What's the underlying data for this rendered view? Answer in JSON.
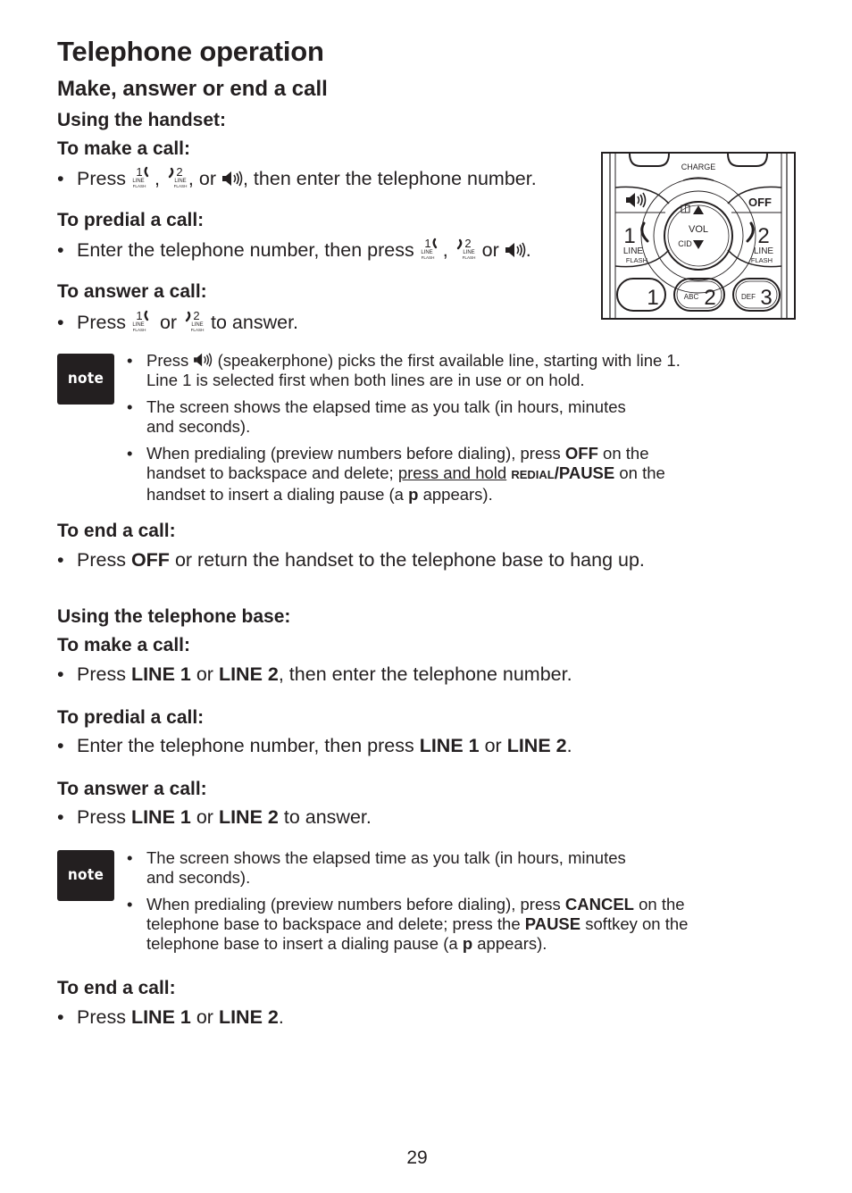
{
  "page": {
    "title": "Telephone operation",
    "section_title": "Make, answer or end a call",
    "page_number": "29"
  },
  "handset": {
    "heading": "Using the handset:",
    "make_call": {
      "heading": "To make a call:",
      "prefix": "Press",
      "sep1": ",",
      "sep2": ", or",
      "suffix": ", then enter the telephone number."
    },
    "predial_call": {
      "heading": "To predial a call:",
      "prefix": "Enter the telephone number, then press",
      "sep1": ",",
      "sep2": "or",
      "suffix": "."
    },
    "answer_call": {
      "heading": "To answer a call:",
      "prefix": "Press",
      "sep1": "or",
      "suffix": "to answer."
    },
    "note": {
      "badge": "note",
      "items": [
        {
          "line1_prefix": "Press",
          "line1_suffix": "(speakerphone) picks the first available line, starting with line 1.",
          "line2": "Line 1 is selected first when both lines are in use or on hold."
        },
        {
          "line1": "The screen shows the elapsed time as you talk (in hours, minutes",
          "line2": "and seconds)."
        },
        {
          "line1_prefix": "When predialing (preview numbers before dialing), press",
          "line1_bold": "OFF",
          "line1_suffix": "on the",
          "line2_prefix": "handset to backspace and delete;",
          "line2_underline": "press and hold",
          "line2_smallcaps": "REDIAL",
          "line2_bold": "/PAUSE",
          "line2_suffix": "on the",
          "line3_prefix": "handset to insert a dialing pause (a",
          "line3_bold": "p",
          "line3_suffix": "appears)."
        }
      ]
    },
    "end_call": {
      "heading": "To end a call:",
      "prefix": "Press",
      "bold": "OFF",
      "suffix": "or return the handset to the telephone base to hang up."
    }
  },
  "base": {
    "heading": "Using the telephone base:",
    "make_call": {
      "heading": "To make a call:",
      "prefix": "Press",
      "bold1": "LINE 1",
      "mid": "or",
      "bold2": "LINE 2",
      "suffix": ", then enter the telephone number."
    },
    "predial_call": {
      "heading": "To predial a call:",
      "prefix": "Enter the telephone number, then press",
      "bold1": "LINE 1",
      "mid": "or",
      "bold2": "LINE 2",
      "suffix": "."
    },
    "answer_call": {
      "heading": "To answer a call:",
      "prefix": "Press",
      "bold1": "LINE 1",
      "mid": "or",
      "bold2": "LINE 2",
      "suffix": "to answer."
    },
    "note": {
      "badge": "note",
      "items": [
        {
          "line1": "The screen shows the elapsed time as you talk (in hours, minutes",
          "line2": "and seconds)."
        },
        {
          "line1_prefix": "When predialing (preview numbers before dialing), press",
          "line1_bold": "CANCEL",
          "line1_suffix": "on the",
          "line2_prefix": "telephone base to backspace and delete; press the",
          "line2_bold": "PAUSE",
          "line2_suffix": "softkey on the",
          "line3_prefix": "telephone base to insert a dialing pause (a",
          "line3_bold": "p",
          "line3_suffix": "appears)."
        }
      ]
    },
    "end_call": {
      "heading": "To end a call:",
      "prefix": "Press",
      "bold1": "LINE 1",
      "mid": "or",
      "bold2": "LINE 2",
      "suffix": "."
    }
  },
  "illustration": {
    "charge_label": "CHARGE",
    "off_label": "OFF",
    "vol_label": "VOL",
    "cid_label": "CID",
    "line1_digit": "1",
    "line2_digit": "2",
    "line_label": "LINE",
    "flash_label": "FLASH",
    "keys": [
      {
        "letters": "",
        "digit": "1"
      },
      {
        "letters": "ABC",
        "digit": "2"
      },
      {
        "letters": "DEF",
        "digit": "3"
      }
    ]
  },
  "icons": {
    "line1_key": "line1-flash-icon",
    "line2_key": "line2-flash-icon",
    "speaker_key": "speakerphone-icon"
  },
  "colors": {
    "text": "#231f20",
    "note_badge_bg": "#231f20",
    "background": "#ffffff"
  }
}
